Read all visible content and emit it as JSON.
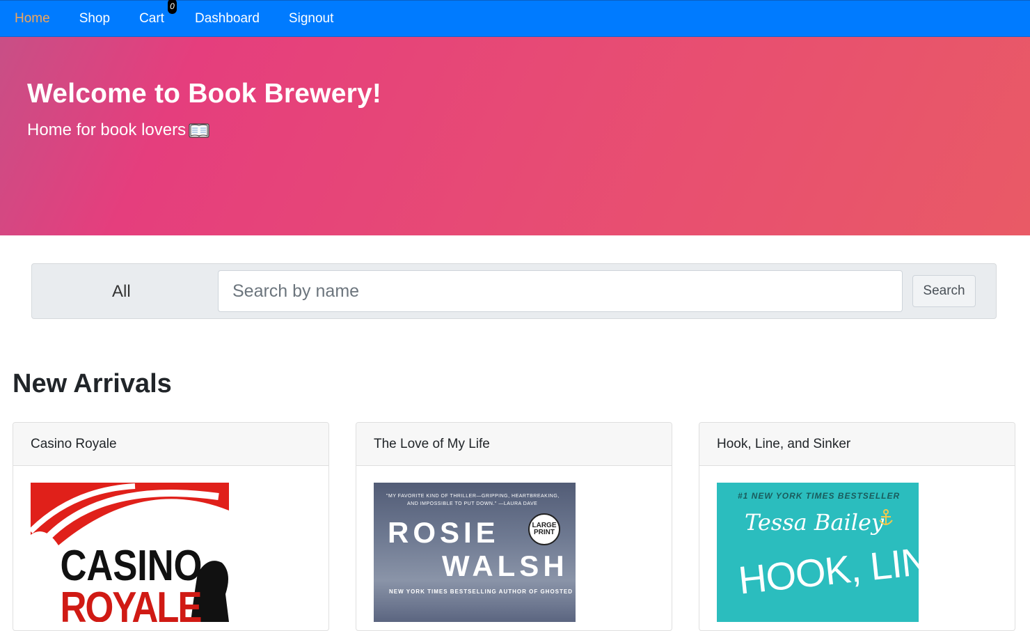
{
  "nav": {
    "items": [
      {
        "label": "Home",
        "active": true
      },
      {
        "label": "Shop"
      },
      {
        "label": "Cart"
      },
      {
        "label": "Dashboard"
      },
      {
        "label": "Signout"
      }
    ],
    "cart_count": "0",
    "accent_active": "#f2a65a",
    "background": "#007bff"
  },
  "hero": {
    "title": "Welcome to Book Brewery!",
    "subtitle": "Home for book lovers",
    "icon": "open-book-icon"
  },
  "search": {
    "category_selected": "All",
    "placeholder": "Search by name",
    "button_label": "Search"
  },
  "new_arrivals": {
    "title": "New Arrivals",
    "books": [
      {
        "title": "Casino Royale",
        "cover": {
          "line1": "CASINO",
          "line2": "ROYALE"
        }
      },
      {
        "title": "The Love of My Life",
        "cover": {
          "quote": "\"MY FAVORITE KIND OF THRILLER—GRIPPING, HEARTBREAKING,",
          "quote2": "AND IMPOSSIBLE TO PUT DOWN.\" —LAURA DAVE",
          "author_first": "ROSIE",
          "author_last": "WALSH",
          "badge": "LARGE PRINT",
          "tagline": "NEW YORK TIMES BESTSELLING AUTHOR OF GHOSTED"
        }
      },
      {
        "title": "Hook, Line, and Sinker",
        "cover": {
          "tagline": "#1 NEW YORK TIMES BESTSELLER",
          "author": "Tessa Bailey",
          "title_art": "HOOK, LINE,"
        }
      }
    ]
  }
}
